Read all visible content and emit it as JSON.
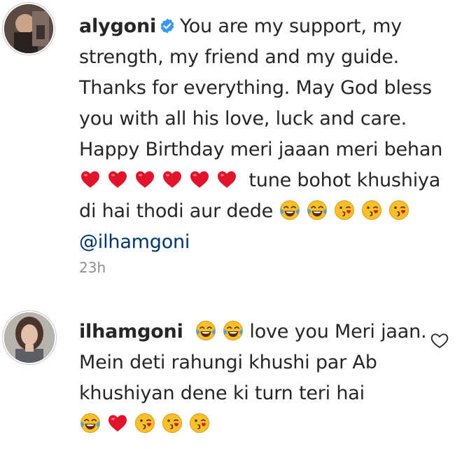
{
  "comments": [
    {
      "username": "alygoni",
      "verified": true,
      "text_a": "You are my support, my strength, my friend and my guide. Thanks for everything. May God bless you with all his love, luck and care. Happy Birthday meri jaaan meri behan",
      "emojis_a": [
        "red-heart-icon",
        "red-heart-icon",
        "red-heart-icon",
        "red-heart-icon",
        "red-heart-icon",
        "red-heart-icon"
      ],
      "text_b": "tune bohot khushiya di hai thodi aur dede",
      "emojis_b": [
        "tears-of-joy-icon",
        "tears-of-joy-icon",
        "kissing-face-icon",
        "kissing-face-icon",
        "kissing-face-icon"
      ],
      "mention": "@ilhamgoni",
      "timestamp": "23h"
    },
    {
      "username": "ilhamgoni",
      "verified": false,
      "emojis_a": [
        "tears-of-joy-icon",
        "tears-of-joy-icon"
      ],
      "text_a": "love you Meri jaan. Mein deti rahungi khushi par Ab khushiyan dene ki turn teri hai",
      "emojis_b": [
        "tears-of-joy-icon",
        "red-heart-icon",
        "kissing-face-icon",
        "kissing-face-icon",
        "kissing-face-icon"
      ]
    }
  ],
  "colors": {
    "text": "#262626",
    "muted": "#8e8e8e",
    "mention": "#00376b",
    "verified": "#3897f0",
    "heart": "#e0142a",
    "emoji_face": "#f7c02b"
  }
}
